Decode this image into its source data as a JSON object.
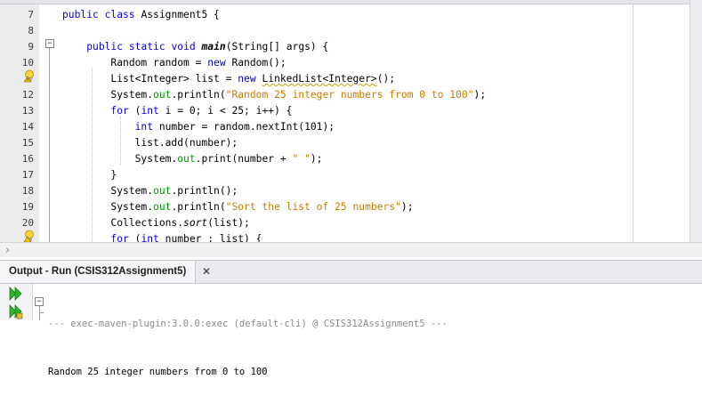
{
  "editor": {
    "lines": [
      {
        "num": "7",
        "parts": [
          [
            "kw",
            "public"
          ],
          [
            "t",
            " "
          ],
          [
            "kw",
            "class"
          ],
          [
            "t",
            " Assignment5 {"
          ]
        ]
      },
      {
        "num": "8",
        "parts": []
      },
      {
        "num": "9",
        "parts": [
          [
            "t",
            "    "
          ],
          [
            "kw",
            "public"
          ],
          [
            "t",
            " "
          ],
          [
            "kw",
            "static"
          ],
          [
            "t",
            " "
          ],
          [
            "kw",
            "void"
          ],
          [
            "t",
            " "
          ],
          [
            "meth",
            "main"
          ],
          [
            "t",
            "(String[] args) {"
          ]
        ]
      },
      {
        "num": "10",
        "parts": [
          [
            "t",
            "        Random random = "
          ],
          [
            "kw",
            "new"
          ],
          [
            "t",
            " Random();"
          ]
        ]
      },
      {
        "num": "",
        "parts": [
          [
            "t",
            "        List<Integer> list = "
          ],
          [
            "kw",
            "new"
          ],
          [
            "t",
            " "
          ],
          [
            "warn",
            "LinkedList<Integer>"
          ],
          [
            "t",
            "();"
          ]
        ]
      },
      {
        "num": "12",
        "parts": [
          [
            "t",
            "        System."
          ],
          [
            "fld",
            "out"
          ],
          [
            "t",
            ".println("
          ],
          [
            "str",
            "\"Random 25 integer numbers from 0 to 100\""
          ],
          [
            "t",
            ");"
          ]
        ]
      },
      {
        "num": "13",
        "parts": [
          [
            "t",
            "        "
          ],
          [
            "kw",
            "for"
          ],
          [
            "t",
            " ("
          ],
          [
            "kw",
            "int"
          ],
          [
            "t",
            " i = 0; i < 25; i++) {"
          ]
        ]
      },
      {
        "num": "14",
        "parts": [
          [
            "t",
            "            "
          ],
          [
            "kw",
            "int"
          ],
          [
            "t",
            " number = random.nextInt(101);"
          ]
        ]
      },
      {
        "num": "15",
        "parts": [
          [
            "t",
            "            list.add(number);"
          ]
        ]
      },
      {
        "num": "16",
        "parts": [
          [
            "t",
            "            System."
          ],
          [
            "fld",
            "out"
          ],
          [
            "t",
            ".print(number + "
          ],
          [
            "str",
            "\" \""
          ],
          [
            "t",
            ");"
          ]
        ]
      },
      {
        "num": "17",
        "parts": [
          [
            "t",
            "        }"
          ]
        ]
      },
      {
        "num": "18",
        "parts": [
          [
            "t",
            "        System."
          ],
          [
            "fld",
            "out"
          ],
          [
            "t",
            ".println();"
          ]
        ]
      },
      {
        "num": "19",
        "parts": [
          [
            "t",
            "        System."
          ],
          [
            "fld",
            "out"
          ],
          [
            "t",
            ".println("
          ],
          [
            "str",
            "\"Sort the list of 25 numbers\""
          ],
          [
            "t",
            ");"
          ]
        ]
      },
      {
        "num": "20",
        "parts": [
          [
            "t",
            "        Collections."
          ],
          [
            "stat",
            "sort"
          ],
          [
            "t",
            "(list);"
          ]
        ]
      },
      {
        "num": "",
        "parts": [
          [
            "t",
            "        "
          ],
          [
            "kw",
            "for"
          ],
          [
            "t",
            " ("
          ],
          [
            "kw",
            "int"
          ],
          [
            "t",
            " number : list) {"
          ]
        ]
      }
    ],
    "hint_icon": "lightbulb-warning-icon",
    "fold_icon": "fold-minus-icon"
  },
  "output": {
    "tab_label": "Output - Run (CSIS312Assignment5)",
    "close_label": "✕",
    "lines": [
      "--- exec-maven-plugin:3.0.0:exec (default-cli) @ CSIS312Assignment5 ---",
      "Random 25 integer numbers from 0 to 100"
    ],
    "toolbar_icons": [
      "rerun-icon",
      "rerun-with-options-icon"
    ],
    "colors": {
      "rerun": "#2db52d",
      "keyword": "#0000e6",
      "string": "#ce7b00",
      "field": "#009900"
    }
  }
}
